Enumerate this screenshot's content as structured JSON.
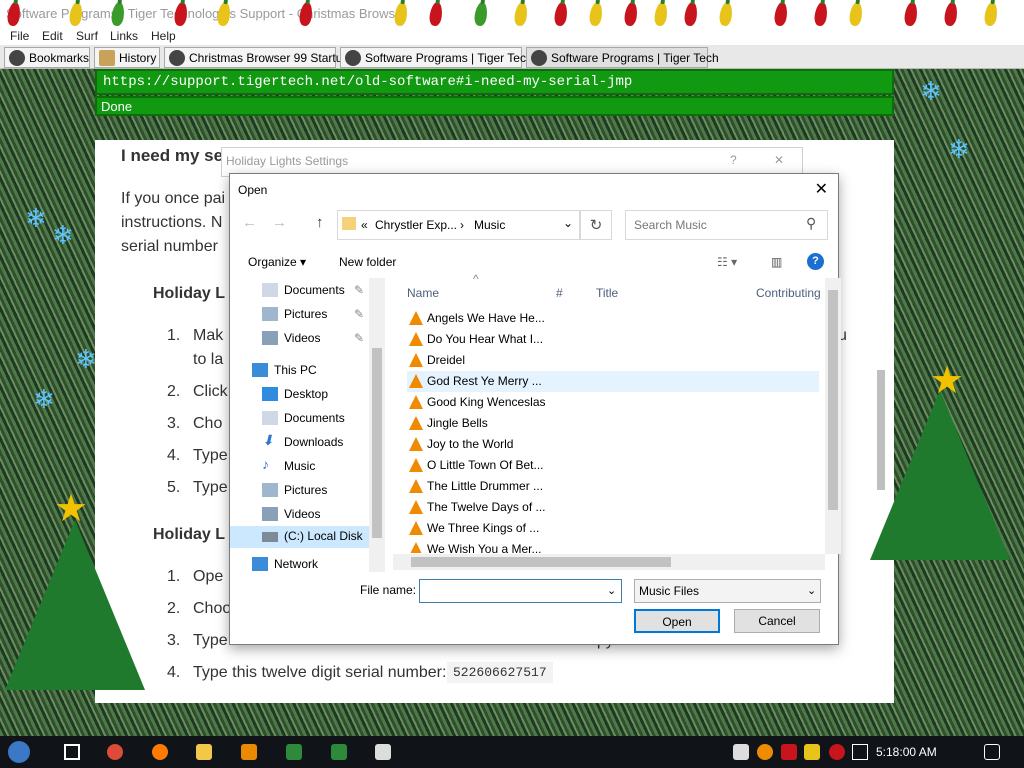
{
  "window": {
    "title": "Software Programs | Tiger Technologies Support - Christmas Browser"
  },
  "menu": [
    "File",
    "Edit",
    "Surf",
    "Links",
    "Help"
  ],
  "tabs": [
    "Bookmarks",
    "History",
    "Christmas Browser 99 Startup",
    "Software Programs | Tiger Tech",
    "Software Programs | Tiger Tech"
  ],
  "address": {
    "url": "https://support.tigertech.net/old-software#i-need-my-serial-jmp"
  },
  "status": {
    "text": "Done"
  },
  "page": {
    "heading": "I need my se",
    "para": [
      "If you once pai",
      "instructions. N",
      "serial number"
    ],
    "sub1": "Holiday L",
    "steps1": [
      {
        "n": "1.",
        "t": "Mak"
      },
      {
        "n": "",
        "t": "to la"
      },
      {
        "n": "2.",
        "t": "Click"
      },
      {
        "n": "3.",
        "t": "Cho"
      },
      {
        "n": "4.",
        "t": "Type"
      },
      {
        "n": "5.",
        "t": "Type"
      }
    ],
    "sub2": "Holiday L",
    "steps2": [
      {
        "n": "1.",
        "t": "Ope"
      },
      {
        "n": "2.",
        "t": "Choo"
      },
      {
        "n": "3.",
        "t": "Type"
      },
      {
        "n": "4.",
        "t": "Type this twelve digit serial number:"
      }
    ],
    "serial": "522606627517",
    "frag_u": "u",
    "frag_copy": "copy"
  },
  "settings_dialog": {
    "title": "Holiday Lights Settings",
    "help": "?",
    "close": "✕"
  },
  "open_dialog": {
    "title": "Open",
    "close": "✕",
    "breadcrumb": {
      "sep": "«",
      "parent": "Chrystler Exp...",
      "arrow": "›",
      "current": "Music"
    },
    "search_placeholder": "Search Music",
    "organize": "Organize ▾",
    "new_folder": "New folder",
    "nav": [
      {
        "label": "Documents",
        "pinned": true
      },
      {
        "label": "Pictures",
        "pinned": true
      },
      {
        "label": "Videos",
        "pinned": true
      },
      {
        "label": "This PC",
        "pinned": false
      },
      {
        "label": "Desktop",
        "pinned": false
      },
      {
        "label": "Documents",
        "pinned": false
      },
      {
        "label": "Downloads",
        "pinned": false
      },
      {
        "label": "Music",
        "pinned": false
      },
      {
        "label": "Pictures",
        "pinned": false
      },
      {
        "label": "Videos",
        "pinned": false
      },
      {
        "label": "(C:) Local Disk",
        "pinned": false
      },
      {
        "label": "Network",
        "pinned": false
      }
    ],
    "columns": [
      "Name",
      "#",
      "Title",
      "Contributing"
    ],
    "files": [
      "Angels We Have He...",
      "Do You Hear What I...",
      "Dreidel",
      "God Rest Ye Merry ...",
      "Good King Wenceslas",
      "Jingle Bells",
      "Joy to the World",
      "O Little Town Of Bet...",
      "The Little Drummer ...",
      "The Twelve Days of ...",
      "We Three Kings of ...",
      "We Wish You a Mer..."
    ],
    "selected_index": 3,
    "file_name_label": "File name:",
    "file_name_value": "",
    "filter": "Music Files",
    "open_btn": "Open",
    "cancel_btn": "Cancel"
  },
  "taskbar": {
    "clock": "5:18:00 AM"
  },
  "colors": {
    "url_bg": "#119a11",
    "accent": "#0078d7"
  }
}
